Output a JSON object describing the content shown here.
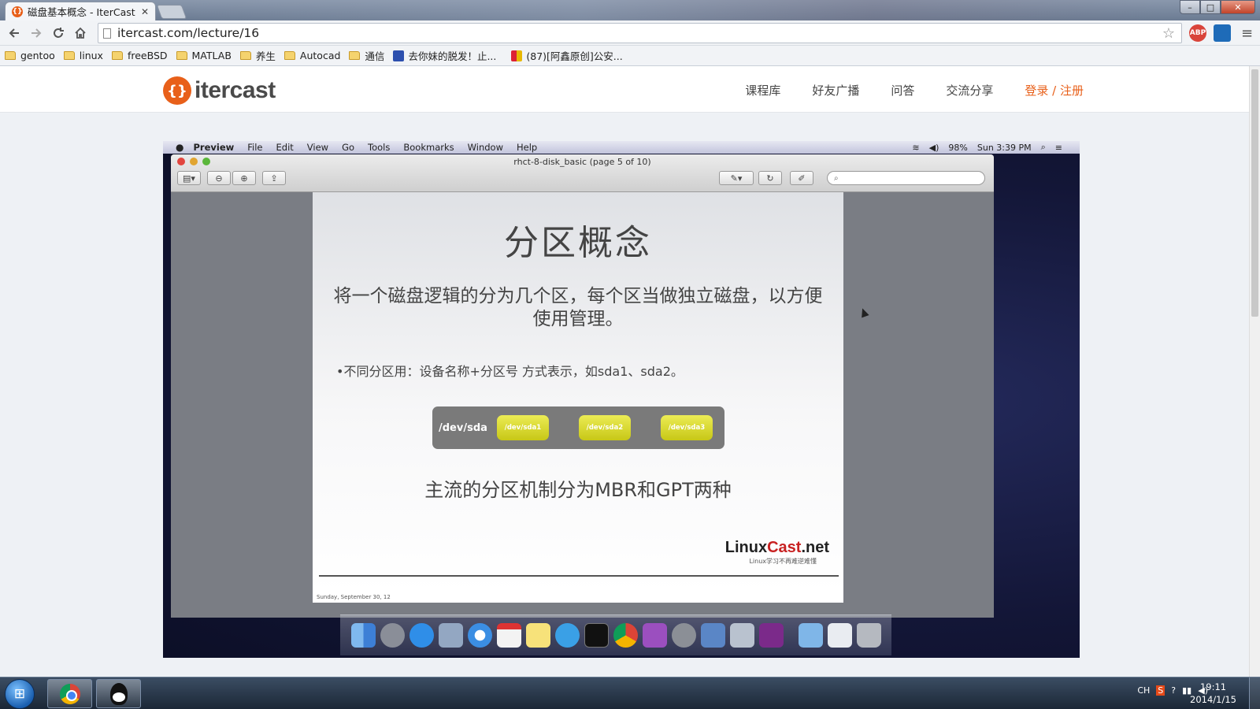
{
  "browser": {
    "tab_title": "磁盘基本概念 - IterCast",
    "tab_close": "✕",
    "url": "itercast.com/lecture/16",
    "window_buttons": {
      "minimize": "–",
      "maximize": "□",
      "close": "✕"
    },
    "extensions": [
      {
        "name": "abp",
        "label": "ABP",
        "color": "#d9443a"
      },
      {
        "name": "extension",
        "label": "",
        "color": "#1e6bb8"
      }
    ],
    "bookmarks": [
      {
        "label": "gentoo",
        "type": "folder"
      },
      {
        "label": "linux",
        "type": "folder"
      },
      {
        "label": "freeBSD",
        "type": "folder"
      },
      {
        "label": "MATLAB",
        "type": "folder"
      },
      {
        "label": "养生",
        "type": "folder"
      },
      {
        "label": "Autocad",
        "type": "folder"
      },
      {
        "label": "通信",
        "type": "folder"
      },
      {
        "label": "去你妹的脱发！止...",
        "type": "page"
      },
      {
        "label": "(87)[阿鑫原创]公安...",
        "type": "page"
      }
    ]
  },
  "site": {
    "logo_text": "itercast",
    "logo_mark": "{}",
    "nav": [
      "课程库",
      "好友广播",
      "问答",
      "交流分享"
    ],
    "login": "登录 / 注册"
  },
  "mac": {
    "menubar": {
      "app": "Preview",
      "items": [
        "File",
        "Edit",
        "View",
        "Go",
        "Tools",
        "Bookmarks",
        "Window",
        "Help"
      ],
      "battery": "98%",
      "clock": "Sun 3:39 PM"
    },
    "window_title": "rhct-8-disk_basic (page 5 of 10)"
  },
  "slide": {
    "title": "分区概念",
    "description": "将一个磁盘逻辑的分为几个区，每个区当做独立磁盘，以方便使用管理。",
    "bullet": "•不同分区用：设备名称+分区号 方式表示，如sda1、sda2。",
    "disk_label": "/dev/sda",
    "partitions": [
      "/dev/sda1",
      "/dev/sda2",
      "/dev/sda3"
    ],
    "note": "主流的分区机制分为MBR和GPT两种",
    "brand_main": "Linux",
    "brand_accent": "Cast",
    "brand_tld": ".net",
    "brand_tagline": "Linux学习不再难逆难懂",
    "footer_date": "Sunday, September 30, 12"
  },
  "taskbar": {
    "tray_lang": "CH",
    "time": "19:11",
    "date": "2014/1/15"
  }
}
